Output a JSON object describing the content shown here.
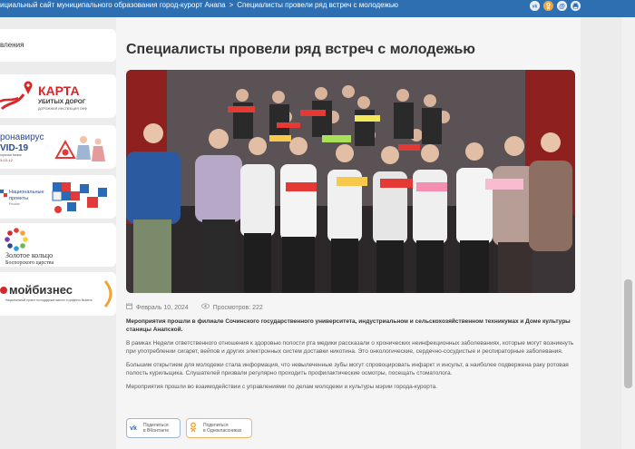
{
  "breadcrumb": {
    "site": "ициальный сайт муниципального образования город-курорт Анапа",
    "separator": ">",
    "current": "Специалисты провели ряд встреч с молодежью"
  },
  "top_icons": {
    "vk": "vk",
    "ok": "ok",
    "mail": "@",
    "print": "print"
  },
  "sidebar": {
    "title": "вления",
    "banners": [
      {
        "big": "КАРТА",
        "small": "УБИТЫХ ДОРОГ",
        "sub": "ДОРОЖНАЯ ИНСПЕКЦИЯ ОНФ"
      },
      {
        "big": "ронавирус",
        "big2": "VID-19",
        "small": "горячая линия:",
        "sub": "3-03-12"
      },
      {
        "big": "Национальные",
        "big2": "проекты",
        "sub": "России"
      },
      {
        "big": "Золотое кольцо",
        "small": "Боспорского царства"
      },
      {
        "big": "мойбизнес",
        "small": "Национальный проект по поддержке малого и среднего бизнеса"
      }
    ]
  },
  "article": {
    "title": "Специалисты провели ряд встреч с молодежью",
    "date": "Февраль 10, 2024",
    "views": "Просмотров: 222",
    "lead": "Мероприятия прошли в филиале Сочинского государственного университета, индустриальном и сельскохозяйственном техникумах и Доме культуры станицы Анапской.",
    "paragraphs": [
      "В рамках Недели ответственного отношения к здоровью полости рта медики рассказали о хронических неинфекционных заболеваниях, которые могут возникнуть при употреблении сигарет, вейпов и других электронных систем доставки никотина. Это онкологические, сердечно-сосудистые и респираторные заболевания.",
      "Большим открытием для молодежи стала информация, что невылеченные зубы могут спровоцировать инфаркт и инсульт, а наиболее подвержена раку ротовая полость курильщика. Слушателей призвали регулярно проходить профилактические осмотры, посещать стоматолога.",
      "Мероприятия прошли во взаимодействии с управлениями по делам молодежи и культуры мэрии города-курорта."
    ]
  },
  "share": {
    "vk_line1": "Поделиться",
    "vk_line2": "в ВКонтакте",
    "ok_line1": "Поделиться",
    "ok_line2": "в Одноклассниках"
  }
}
